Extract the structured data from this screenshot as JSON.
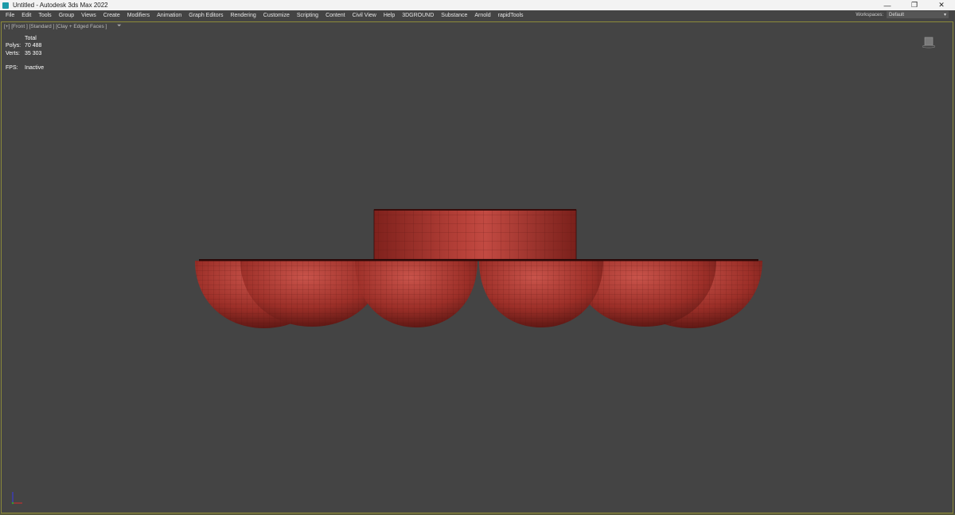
{
  "window": {
    "title": "Untitled - Autodesk 3ds Max 2022",
    "minimize_glyph": "—",
    "restore_glyph": "❐",
    "close_glyph": "✕"
  },
  "menu": {
    "items": [
      "File",
      "Edit",
      "Tools",
      "Group",
      "Views",
      "Create",
      "Modifiers",
      "Animation",
      "Graph Editors",
      "Rendering",
      "Customize",
      "Scripting",
      "Content",
      "Civil View",
      "Help",
      "3DGROUND",
      "Substance",
      "Arnold",
      "rapidTools"
    ]
  },
  "workspace": {
    "label": "Workspaces:",
    "value": "Default"
  },
  "viewport": {
    "label": "[+] [Front ] [Standard ] [Clay + Edged Faces ]",
    "stats": {
      "header": "Total",
      "polys_label": "Polys:",
      "polys_value": "70 488",
      "verts_label": "Verts:",
      "verts_value": "35 303",
      "fps_label": "FPS:",
      "fps_value": "Inactive"
    }
  },
  "colors": {
    "viewport_bg": "#444444",
    "clay_red": "#a8352e",
    "viewport_border": "#8d8b3a"
  },
  "icons": {
    "app": "3ds-max-app-icon",
    "viewcube": "viewcube-icon",
    "axis": "axis-tripod-icon",
    "filter": "viewport-filter-icon"
  }
}
